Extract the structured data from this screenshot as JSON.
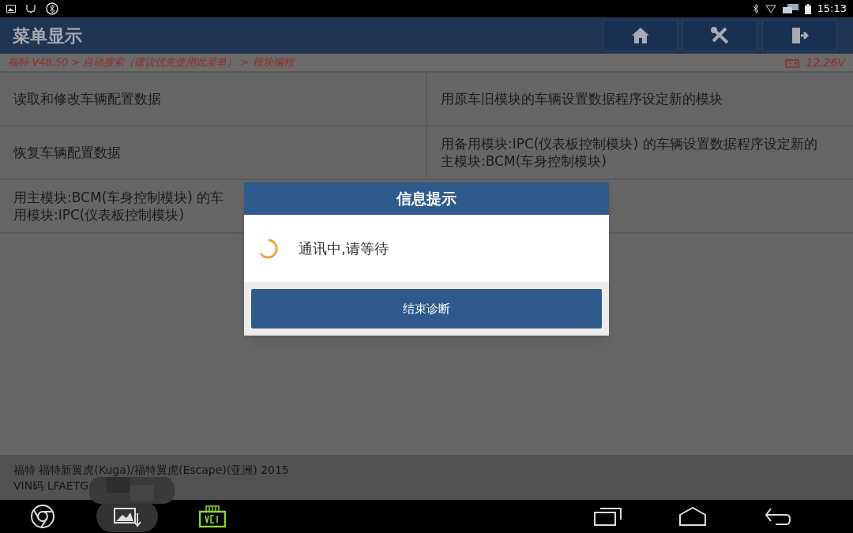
{
  "status_bar": {
    "time": "15:13"
  },
  "header": {
    "title": "菜单显示"
  },
  "breadcrumb": {
    "path": "福特 V48.50 > 自动搜索（建议优先使用此菜单） > 模块编程",
    "voltage": "12.26V"
  },
  "menu_rows": [
    {
      "cells": [
        {
          "lines": [
            "读取和修改车辆配置数据"
          ]
        },
        {
          "lines": [
            "用原车旧模块的车辆设置数据程序设定新的模块"
          ]
        }
      ]
    },
    {
      "cells": [
        {
          "lines": [
            "恢复车辆配置数据"
          ]
        },
        {
          "lines": [
            "用备用模块:IPC(仪表板控制模块) 的车辆设置数据程序设定新的",
            "主模块:BCM(车身控制模块)"
          ]
        }
      ]
    },
    {
      "cells": [
        {
          "lines": [
            "用主模块:BCM(车身控制模块) 的车",
            "用模块:IPC(仪表板控制模块)"
          ]
        }
      ]
    }
  ],
  "vehicle_info": {
    "model": "福特 福特新翼虎(Kuga)/福特翼虎(Escape)(亚洲) 2015",
    "vin": "VIN码 LFAETG"
  },
  "dialog": {
    "title": "信息提示",
    "message": "通讯中,请等待",
    "button": "结束诊断"
  }
}
